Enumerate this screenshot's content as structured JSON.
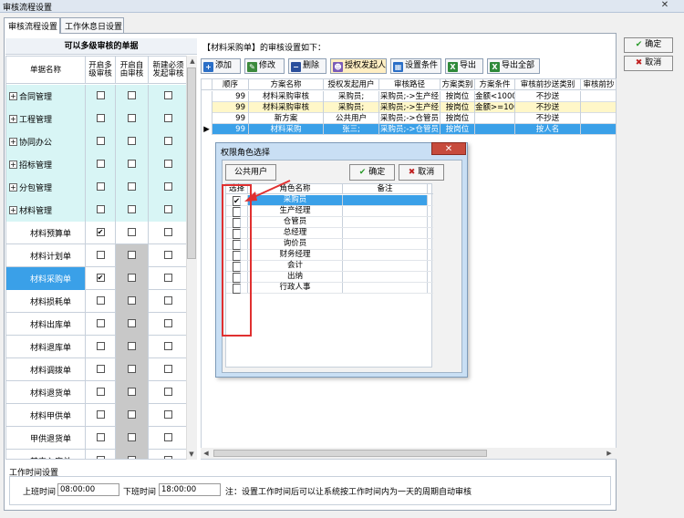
{
  "window": {
    "title": "审核流程设置",
    "close": "✕"
  },
  "tabs": [
    {
      "label": "审核流程设置"
    },
    {
      "label": "工作休息日设置"
    }
  ],
  "left": {
    "header": "可以多级审核的单据",
    "columns": [
      "单据名称",
      "开启多级审核",
      "开启自由审核",
      "新建必须发起审核"
    ],
    "rows": [
      {
        "name": "合同管理",
        "group": true,
        "c1": false,
        "c2": false,
        "c3": false
      },
      {
        "name": "工程管理",
        "group": true,
        "c1": false,
        "c2": false,
        "c3": false
      },
      {
        "name": "协同办公",
        "group": true,
        "c1": false,
        "c2": false,
        "c3": false
      },
      {
        "name": "招标管理",
        "group": true,
        "c1": false,
        "c2": false,
        "c3": false
      },
      {
        "name": "分包管理",
        "group": true,
        "c1": false,
        "c2": false,
        "c3": false
      },
      {
        "name": "材料管理",
        "group": true,
        "c1": false,
        "c2": false,
        "c3": false
      },
      {
        "name": "材料预算单",
        "group": false,
        "c1": true,
        "c2": false,
        "c3": false
      },
      {
        "name": "材料计划单",
        "group": false,
        "c1": false,
        "c2": false,
        "c3": false
      },
      {
        "name": "材料采购单",
        "group": false,
        "c1": true,
        "c2": false,
        "c3": false,
        "selected": true
      },
      {
        "name": "材料损耗单",
        "group": false,
        "c1": false,
        "c2": false,
        "c3": false
      },
      {
        "name": "材料出库单",
        "group": false,
        "c1": false,
        "c2": false,
        "c3": false
      },
      {
        "name": "材料退库单",
        "group": false,
        "c1": false,
        "c2": false,
        "c3": false
      },
      {
        "name": "材料调拨单",
        "group": false,
        "c1": false,
        "c2": false,
        "c3": false
      },
      {
        "name": "材料退货单",
        "group": false,
        "c1": false,
        "c2": false,
        "c3": false
      },
      {
        "name": "材料甲供单",
        "group": false,
        "c1": false,
        "c2": false,
        "c3": false
      },
      {
        "name": "甲供退货单",
        "group": false,
        "c1": false,
        "c2": false,
        "c3": false
      },
      {
        "name": "其它入库单",
        "group": false,
        "c1": false,
        "c2": false,
        "c3": false
      }
    ]
  },
  "right": {
    "title": "【材料采购单】的审核设置如下：",
    "toolbar": [
      "添加",
      "修改",
      "删除",
      "授权发起人",
      "设置条件",
      "导出",
      "导出全部"
    ],
    "columns": [
      "顺序",
      "方案名称",
      "授权发起用户",
      "审核路径",
      "方案类别",
      "方案条件",
      "审核前抄送类别",
      "审核前抄"
    ],
    "rows": [
      [
        "99",
        "材料采购审核",
        "采购员;",
        "采购员;->生产经",
        "按岗位",
        "金额<1000",
        "不抄送",
        ""
      ],
      [
        "99",
        "材料采购审核",
        "采购员;",
        "采购员;->生产经",
        "按岗位",
        "金额>=100",
        "不抄送",
        ""
      ],
      [
        "99",
        "新方案",
        "公共用户",
        "采购员;->仓管员",
        "按岗位",
        "",
        "不抄送",
        ""
      ],
      [
        "99",
        "材料采购",
        "张三;",
        "采购员;->仓管员",
        "按岗位",
        "",
        "按人名",
        ""
      ]
    ]
  },
  "side": {
    "ok": "确定",
    "cancel": "取消"
  },
  "worktime": {
    "section": "工作时间设置",
    "start_label": "上班时间",
    "start_value": "08:00:00",
    "end_label": "下班时间",
    "end_value": "18:00:00",
    "note": "注：设置工作时间后可以让系统按工作时间内为一天的周期自动审核"
  },
  "dialog": {
    "title": "权限角色选择",
    "close": "✕",
    "public_btn": "公共用户",
    "ok": "确定",
    "cancel": "取消",
    "columns": [
      "选择",
      "角色名称",
      "备注"
    ],
    "rows": [
      {
        "name": "采购员",
        "checked": true
      },
      {
        "name": "生产经理",
        "checked": false
      },
      {
        "name": "仓管员",
        "checked": false
      },
      {
        "name": "总经理",
        "checked": false
      },
      {
        "name": "询价员",
        "checked": false
      },
      {
        "name": "财务经理",
        "checked": false
      },
      {
        "name": "会计",
        "checked": false
      },
      {
        "name": "出纳",
        "checked": false
      },
      {
        "name": "行政人事",
        "checked": false
      }
    ]
  },
  "colors": {
    "selected": "#3aa0e8",
    "group": "#d8f5f5",
    "highlight": "#fff7c8",
    "accent": "#e03030"
  }
}
